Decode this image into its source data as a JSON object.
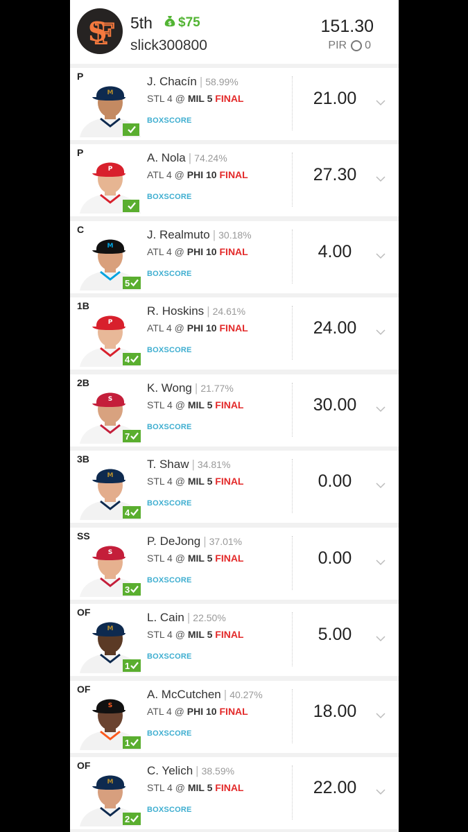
{
  "header": {
    "rank": "5th",
    "winnings": "$75",
    "username": "slick300800",
    "total_points": "151.30",
    "pir_label": "PIR",
    "pir_value": "0"
  },
  "colors": {
    "accent_green": "#5aae2f",
    "final_red": "#e32a2a",
    "boxscore_blue": "#3eaed0"
  },
  "players": [
    {
      "pos": "P",
      "name": "J. Chacín",
      "pct": "58.99%",
      "away": "STL 4",
      "home": "MIL 5",
      "status": "FINAL",
      "boxscore": "BOXSCORE",
      "points": "21.00",
      "badge": "",
      "team": "MIL"
    },
    {
      "pos": "P",
      "name": "A. Nola",
      "pct": "74.24%",
      "away": "ATL 4",
      "home": "PHI 10",
      "status": "FINAL",
      "boxscore": "BOXSCORE",
      "points": "27.30",
      "badge": "",
      "team": "PHI"
    },
    {
      "pos": "C",
      "name": "J. Realmuto",
      "pct": "30.18%",
      "away": "ATL 4",
      "home": "PHI 10",
      "status": "FINAL",
      "boxscore": "BOXSCORE",
      "points": "4.00",
      "badge": "5",
      "team": "MIA"
    },
    {
      "pos": "1B",
      "name": "R. Hoskins",
      "pct": "24.61%",
      "away": "ATL 4",
      "home": "PHI 10",
      "status": "FINAL",
      "boxscore": "BOXSCORE",
      "points": "24.00",
      "badge": "4",
      "team": "PHI"
    },
    {
      "pos": "2B",
      "name": "K. Wong",
      "pct": "21.77%",
      "away": "STL 4",
      "home": "MIL 5",
      "status": "FINAL",
      "boxscore": "BOXSCORE",
      "points": "30.00",
      "badge": "7",
      "team": "STL"
    },
    {
      "pos": "3B",
      "name": "T. Shaw",
      "pct": "34.81%",
      "away": "STL 4",
      "home": "MIL 5",
      "status": "FINAL",
      "boxscore": "BOXSCORE",
      "points": "0.00",
      "badge": "4",
      "team": "MIL"
    },
    {
      "pos": "SS",
      "name": "P. DeJong",
      "pct": "37.01%",
      "away": "STL 4",
      "home": "MIL 5",
      "status": "FINAL",
      "boxscore": "BOXSCORE",
      "points": "0.00",
      "badge": "3",
      "team": "STL"
    },
    {
      "pos": "OF",
      "name": "L. Cain",
      "pct": "22.50%",
      "away": "STL 4",
      "home": "MIL 5",
      "status": "FINAL",
      "boxscore": "BOXSCORE",
      "points": "5.00",
      "badge": "1",
      "team": "MIL"
    },
    {
      "pos": "OF",
      "name": "A. McCutchen",
      "pct": "40.27%",
      "away": "ATL 4",
      "home": "PHI 10",
      "status": "FINAL",
      "boxscore": "BOXSCORE",
      "points": "18.00",
      "badge": "1",
      "team": "SF"
    },
    {
      "pos": "OF",
      "name": "C. Yelich",
      "pct": "38.59%",
      "away": "STL 4",
      "home": "MIL 5",
      "status": "FINAL",
      "boxscore": "BOXSCORE",
      "points": "22.00",
      "badge": "2",
      "team": "MIL"
    }
  ]
}
